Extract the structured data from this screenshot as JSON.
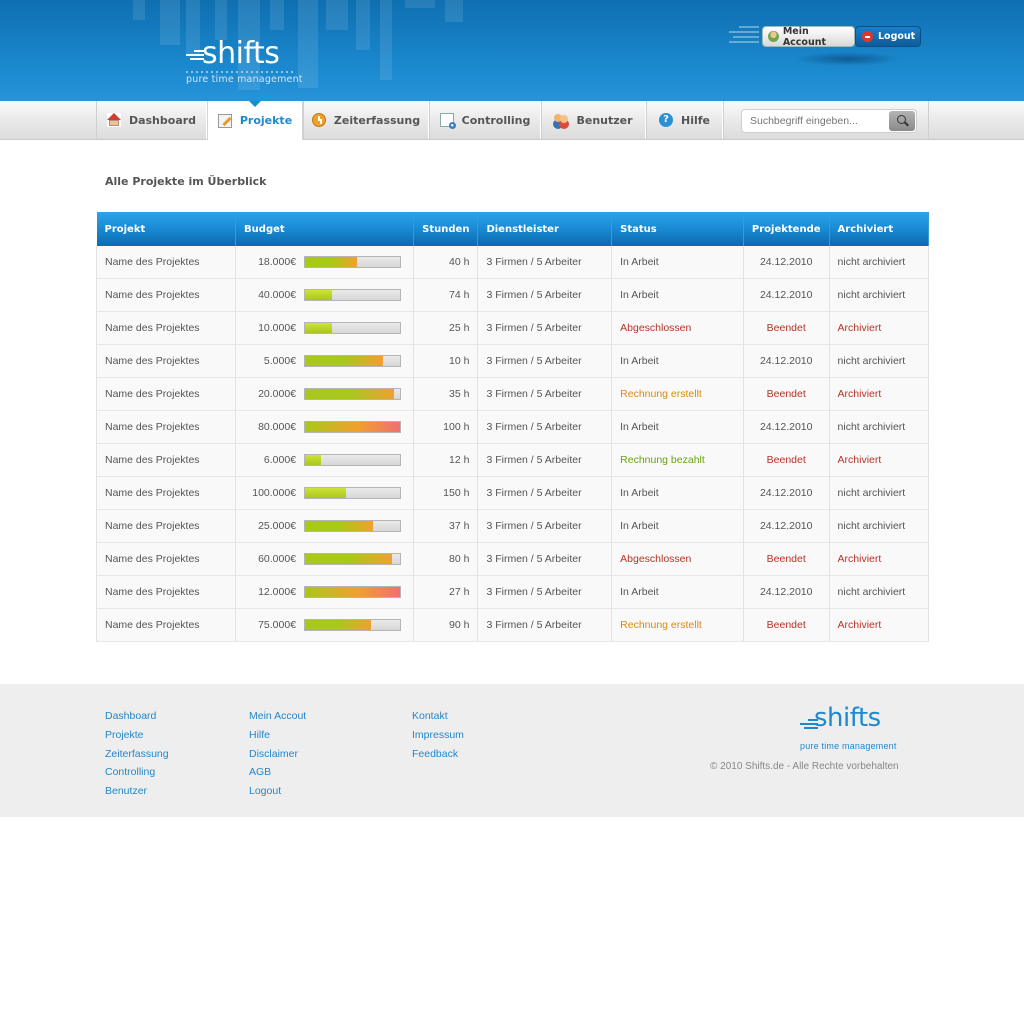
{
  "brand": {
    "name": "shifts",
    "tagline": "pure time management"
  },
  "account": {
    "account_label": "Mein Account",
    "logout_label": "Logout"
  },
  "nav": {
    "tabs": [
      {
        "label": "Dashboard",
        "icon": "home-icon"
      },
      {
        "label": "Projekte",
        "icon": "edit-icon",
        "active": true
      },
      {
        "label": "Zeiterfassung",
        "icon": "clock-icon"
      },
      {
        "label": "Controlling",
        "icon": "document-icon"
      },
      {
        "label": "Benutzer",
        "icon": "users-icon"
      },
      {
        "label": "Hilfe",
        "icon": "help-icon"
      }
    ],
    "search_placeholder": "Suchbegriff eingeben...",
    "search_icon": "magnifier-icon"
  },
  "main": {
    "title": "Alle Projekte im Überblick",
    "columns": [
      "Projekt",
      "Budget",
      "Stunden",
      "Dienstleister",
      "Status",
      "Projektende",
      "Archiviert"
    ],
    "rows": [
      {
        "project": "Name des Projektes",
        "budget": "18.000€",
        "progress": 0.55,
        "hours": "40 h",
        "provider": "3 Firmen / 5 Arbeiter",
        "status": "In Arbeit",
        "end": "24.12.2010",
        "archived": "nicht archiviert"
      },
      {
        "project": "Name des Projektes",
        "budget": "40.000€",
        "progress": 0.28,
        "hours": "74 h",
        "provider": "3 Firmen / 5 Arbeiter",
        "status": "In Arbeit",
        "end": "24.12.2010",
        "archived": "nicht archiviert"
      },
      {
        "project": "Name des Projektes",
        "budget": "10.000€",
        "progress": 0.28,
        "hours": "25 h",
        "provider": "3 Firmen / 5 Arbeiter",
        "status": "Abgeschlossen",
        "end": "Beendet",
        "archived": "Archiviert"
      },
      {
        "project": "Name des Projektes",
        "budget": "5.000€",
        "progress": 0.82,
        "hours": "10 h",
        "provider": "3 Firmen / 5 Arbeiter",
        "status": "In Arbeit",
        "end": "24.12.2010",
        "archived": "nicht archiviert"
      },
      {
        "project": "Name des Projektes",
        "budget": "20.000€",
        "progress": 0.93,
        "hours": "35 h",
        "provider": "3 Firmen / 5 Arbeiter",
        "status": "Rechnung erstellt",
        "end": "Beendet",
        "archived": "Archiviert"
      },
      {
        "project": "Name des Projektes",
        "budget": "80.000€",
        "progress": 1.0,
        "hours": "100 h",
        "provider": "3 Firmen / 5 Arbeiter",
        "status": "In Arbeit",
        "end": "24.12.2010",
        "archived": "nicht archiviert"
      },
      {
        "project": "Name des Projektes",
        "budget": "6.000€",
        "progress": 0.17,
        "hours": "12 h",
        "provider": "3 Firmen / 5 Arbeiter",
        "status": "Rechnung bezahlt",
        "end": "Beendet",
        "archived": "Archiviert"
      },
      {
        "project": "Name des Projektes",
        "budget": "100.000€",
        "progress": 0.43,
        "hours": "150 h",
        "provider": "3 Firmen / 5 Arbeiter",
        "status": "In Arbeit",
        "end": "24.12.2010",
        "archived": "nicht archiviert"
      },
      {
        "project": "Name des Projektes",
        "budget": "25.000€",
        "progress": 0.71,
        "hours": "37 h",
        "provider": "3 Firmen / 5 Arbeiter",
        "status": "In Arbeit",
        "end": "24.12.2010",
        "archived": "nicht archiviert"
      },
      {
        "project": "Name des Projektes",
        "budget": "60.000€",
        "progress": 0.91,
        "hours": "80 h",
        "provider": "3 Firmen / 5 Arbeiter",
        "status": "Abgeschlossen",
        "end": "Beendet",
        "archived": "Archiviert"
      },
      {
        "project": "Name des Projektes",
        "budget": "12.000€",
        "progress": 1.0,
        "hours": "27 h",
        "provider": "3 Firmen / 5 Arbeiter",
        "status": "In Arbeit",
        "end": "24.12.2010",
        "archived": "nicht archiviert"
      },
      {
        "project": "Name des Projektes",
        "budget": "75.000€",
        "progress": 0.69,
        "hours": "90 h",
        "provider": "3 Firmen / 5 Arbeiter",
        "status": "Rechnung erstellt",
        "end": "Beendet",
        "archived": "Archiviert"
      }
    ]
  },
  "footer": {
    "col1": [
      "Dashboard",
      "Projekte",
      "Zeiterfassung",
      "Controlling",
      "Benutzer"
    ],
    "col2": [
      "Mein Accout",
      "Hilfe",
      "Disclaimer",
      "AGB",
      "Logout"
    ],
    "col3": [
      "Kontakt",
      "Impressum",
      "Feedback"
    ],
    "brand_name": "shifts",
    "brand_tagline": "pure time management",
    "copyright": "© 2010 Shifts.de - Alle Rechte vorbehalten"
  },
  "colors": {
    "header_blue": "#1c8ad0",
    "accent_blue": "#1a8bd0",
    "status_red": "#b83227",
    "status_orange": "#d98a0c",
    "status_green": "#6aa30f",
    "bar_green": "#a8c81a",
    "bar_orange": "#f0a030",
    "bar_red": "#f07070"
  }
}
